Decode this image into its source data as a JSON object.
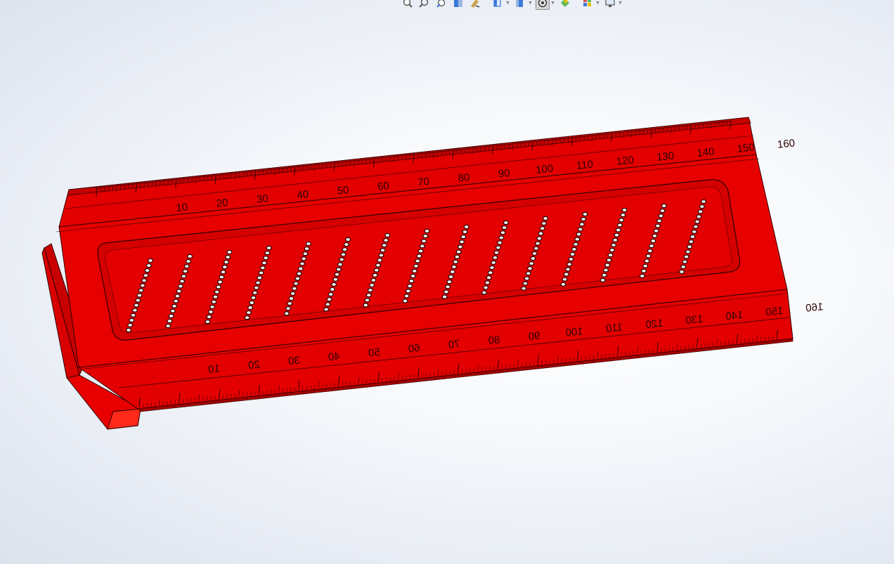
{
  "toolbar": {
    "buttons": [
      {
        "icon": "zoom-to-fit-icon",
        "dropdown": false,
        "active": false
      },
      {
        "icon": "zoom-to-area-icon",
        "dropdown": false,
        "active": false
      },
      {
        "icon": "previous-view-icon",
        "dropdown": false,
        "active": false
      },
      {
        "icon": "section-view-icon",
        "dropdown": false,
        "active": false
      },
      {
        "icon": "dynamic-annotation-icon",
        "dropdown": false,
        "active": false
      },
      {
        "icon": "view-orientation-icon",
        "dropdown": true,
        "active": false
      },
      {
        "icon": "display-style-icon",
        "dropdown": true,
        "active": false
      },
      {
        "icon": "hide-show-items-icon",
        "dropdown": true,
        "active": true
      },
      {
        "icon": "edit-appearance-icon",
        "dropdown": false,
        "active": false
      },
      {
        "icon": "apply-scene-icon",
        "dropdown": true,
        "active": false
      },
      {
        "icon": "view-settings-icon",
        "dropdown": true,
        "active": false
      }
    ]
  },
  "model": {
    "color": "#e50000",
    "color_dark": "#b80000",
    "color_light": "#ff2a1a",
    "top_scale_labels": [
      "10",
      "20",
      "30",
      "40",
      "50",
      "60",
      "70",
      "80",
      "90",
      "100",
      "110",
      "120",
      "130",
      "140",
      "150",
      "160"
    ],
    "bottom_scale_labels": [
      "10",
      "20",
      "30",
      "40",
      "50",
      "60",
      "70",
      "80",
      "90",
      "100",
      "110",
      "120",
      "130",
      "140",
      "150",
      "160"
    ],
    "hole_rows": 15,
    "holes_per_row": 15
  }
}
